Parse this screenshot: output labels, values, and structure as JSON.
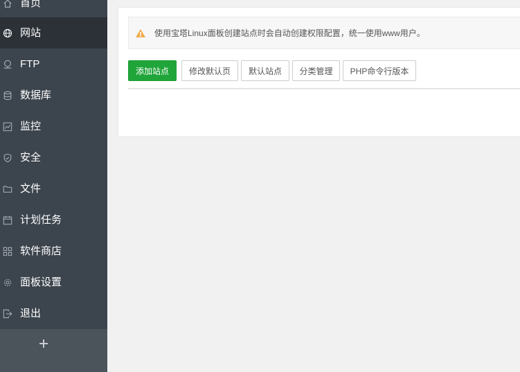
{
  "sidebar": {
    "items": [
      {
        "label": "首页",
        "icon": "home-icon"
      },
      {
        "label": "网站",
        "icon": "globe-icon",
        "active": true
      },
      {
        "label": "FTP",
        "icon": "ftp-icon"
      },
      {
        "label": "数据库",
        "icon": "database-icon"
      },
      {
        "label": "监控",
        "icon": "monitor-icon"
      },
      {
        "label": "安全",
        "icon": "shield-icon"
      },
      {
        "label": "文件",
        "icon": "folder-icon"
      },
      {
        "label": "计划任务",
        "icon": "calendar-icon"
      },
      {
        "label": "软件商店",
        "icon": "grid-icon"
      },
      {
        "label": "面板设置",
        "icon": "gear-icon"
      },
      {
        "label": "退出",
        "icon": "logout-icon"
      }
    ],
    "add_label": "+"
  },
  "notice": {
    "text": "使用宝塔Linux面板创建站点时会自动创建权限配置，统一使用www用户。",
    "icon": "warning-icon"
  },
  "toolbar": {
    "add_site": "添加站点",
    "edit_default_page": "修改默认页",
    "default_site": "默认站点",
    "category_manage": "分类管理",
    "php_cli_version": "PHP命令行版本"
  },
  "colors": {
    "sidebar_bg": "#3c444d",
    "sidebar_active_bg": "#2c3138",
    "primary_green": "#20a53a",
    "warning_orange": "#f0ad4e"
  }
}
